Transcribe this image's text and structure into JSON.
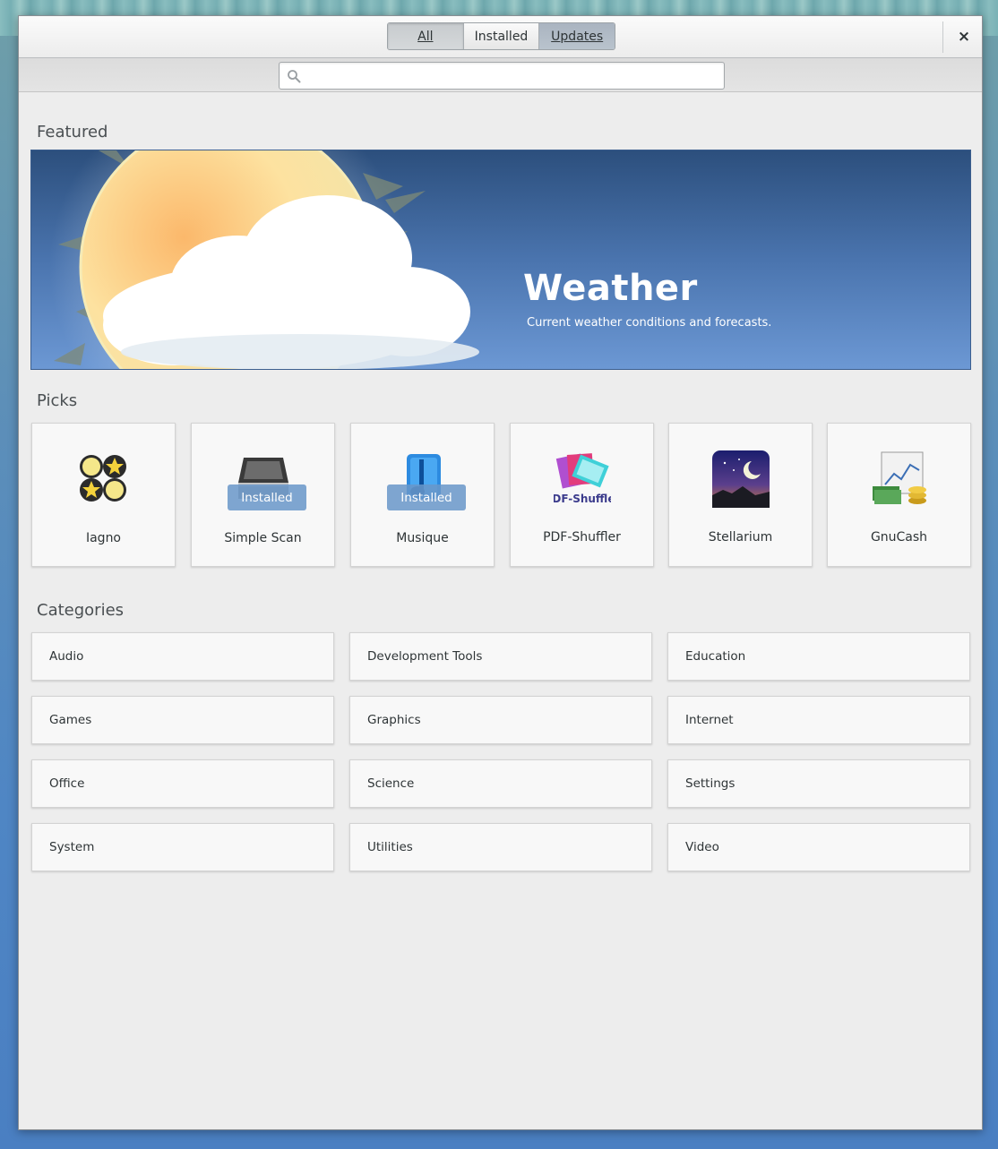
{
  "header": {
    "tabs": [
      {
        "label": "All"
      },
      {
        "label": "Installed"
      },
      {
        "label": "Updates"
      }
    ],
    "close_glyph": "×"
  },
  "search": {
    "placeholder": "",
    "value": "",
    "icon": "search-icon"
  },
  "featured": {
    "section_title": "Featured",
    "app_name": "Weather",
    "description": "Current weather conditions and forecasts."
  },
  "picks": {
    "section_title": "Picks",
    "items": [
      {
        "name": "Iagno",
        "installed": false,
        "icon": "iagno-icon"
      },
      {
        "name": "Simple Scan",
        "installed": true,
        "badge": "Installed",
        "icon": "scanner-icon"
      },
      {
        "name": "Musique",
        "installed": true,
        "badge": "Installed",
        "icon": "music-note-icon"
      },
      {
        "name": "PDF-Shuffler",
        "installed": false,
        "icon": "pdf-shuffler-icon"
      },
      {
        "name": "Stellarium",
        "installed": false,
        "icon": "stellarium-icon"
      },
      {
        "name": "GnuCash",
        "installed": false,
        "icon": "gnucash-icon"
      }
    ]
  },
  "categories": {
    "section_title": "Categories",
    "items": [
      {
        "label": "Audio"
      },
      {
        "label": "Development Tools"
      },
      {
        "label": "Education"
      },
      {
        "label": "Games"
      },
      {
        "label": "Graphics"
      },
      {
        "label": "Internet"
      },
      {
        "label": "Office"
      },
      {
        "label": "Science"
      },
      {
        "label": "Settings"
      },
      {
        "label": "System"
      },
      {
        "label": "Utilities"
      },
      {
        "label": "Video"
      }
    ]
  },
  "colors": {
    "installed_badge": "#6897c9",
    "featured_top": "#2c4f7d",
    "featured_bottom": "#6c98d4"
  }
}
